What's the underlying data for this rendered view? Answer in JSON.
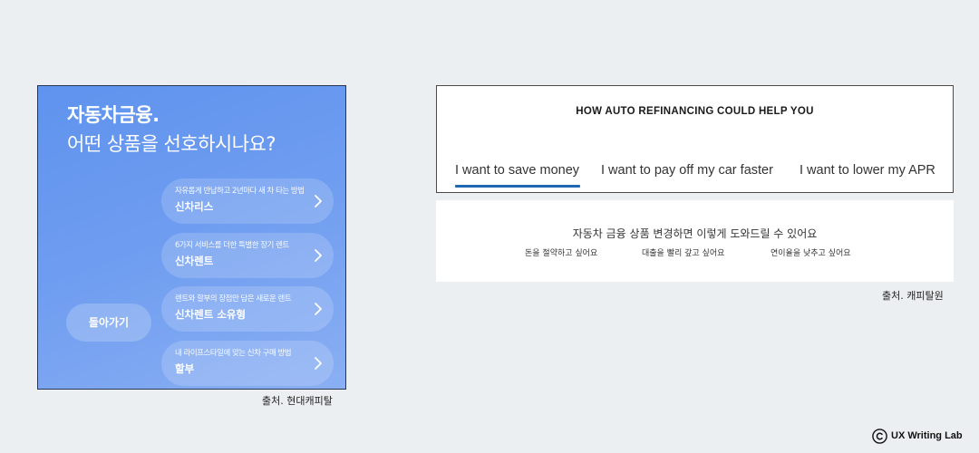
{
  "hyundai_capital": {
    "title": "자동차금융.",
    "subtitle": "어떤 상품을 선호하시나요?",
    "options": [
      {
        "desc": "자유롭게 반납하고 2년마다 새 차 타는 방법",
        "name": "신차리스"
      },
      {
        "desc": "6가지 서비스를 더한 특별한 장기 렌트",
        "name": "신차렌트"
      },
      {
        "desc": "렌트와 할부의 장점만 담은 새로운 렌트",
        "name": "신차렌트 소유형"
      },
      {
        "desc": "내 라이프스타일에 맞는 신차 구매 방법",
        "name": "할부"
      }
    ],
    "back_label": "돌아가기",
    "caption": "출처. 현대캐피탈"
  },
  "capital_one": {
    "heading": "HOW AUTO REFINANCING COULD HELP YOU",
    "tabs": [
      {
        "label": "I want to save money",
        "active": true
      },
      {
        "label": "I want to pay off my car faster",
        "active": false
      },
      {
        "label": "I want to lower my APR",
        "active": false
      }
    ],
    "active_color": "#1f67b1",
    "caption": "출처. 캐피탈원"
  },
  "translation": {
    "main": "자동차 금융 상품 변경하면 이렇게 도와드릴 수 있어요",
    "items": [
      "돈을 절약하고 싶어요",
      "대출을 빨리 갚고 싶어요",
      "연이율을 낮추고 싶어요"
    ]
  },
  "brand": {
    "label": "UX Writing Lab",
    "icon": "copyright-icon"
  }
}
